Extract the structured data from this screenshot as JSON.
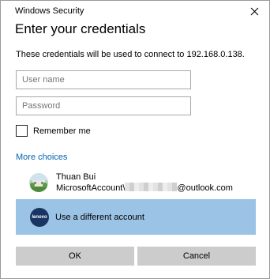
{
  "window": {
    "title": "Windows Security"
  },
  "heading": "Enter your credentials",
  "description": "These credentials will be used to connect to 192.168.0.138.",
  "fields": {
    "username_placeholder": "User name",
    "password_placeholder": "Password"
  },
  "remember_me": {
    "label": "Remember me",
    "checked": false
  },
  "more_choices": "More choices",
  "accounts": [
    {
      "name": "Thuan Bui",
      "email_prefix": "MicrosoftAccount\\",
      "email_suffix": "@outlook.com",
      "icon": "user-photo-icon"
    }
  ],
  "other_account": {
    "label": "Use a different account",
    "icon": "lenovo-logo-icon",
    "logo_text": "lenovo"
  },
  "buttons": {
    "ok": "OK",
    "cancel": "Cancel"
  },
  "colors": {
    "accent": "#0063b1",
    "selected_bg": "#9bc3e6",
    "button_bg": "#cccccc",
    "lenovo": "#1a3563"
  }
}
